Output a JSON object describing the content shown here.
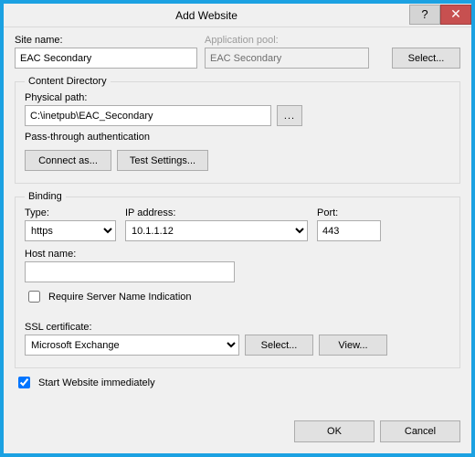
{
  "window": {
    "title": "Add Website",
    "help": "?",
    "close": "✕"
  },
  "top": {
    "siteName_lbl": "Site name:",
    "siteName_val": "EAC Secondary",
    "appPool_lbl": "Application pool:",
    "appPool_val": "EAC Secondary",
    "select_btn": "Select..."
  },
  "content": {
    "legend": "Content Directory",
    "physPath_lbl": "Physical path:",
    "physPath_val": "C:\\inetpub\\EAC_Secondary",
    "browse": "...",
    "passThru_lbl": "Pass-through authentication",
    "connectAs_btn": "Connect as...",
    "testSettings_btn": "Test Settings..."
  },
  "binding": {
    "legend": "Binding",
    "type_lbl": "Type:",
    "type_val": "https",
    "ip_lbl": "IP address:",
    "ip_val": "10.1.1.12",
    "port_lbl": "Port:",
    "port_val": "443",
    "host_lbl": "Host name:",
    "host_val": "",
    "sni_label": "Require Server Name Indication",
    "ssl_lbl": "SSL certificate:",
    "ssl_val": "Microsoft Exchange",
    "sslSelect_btn": "Select...",
    "sslView_btn": "View..."
  },
  "startImmediate_lbl": "Start Website immediately",
  "footer": {
    "ok": "OK",
    "cancel": "Cancel"
  }
}
